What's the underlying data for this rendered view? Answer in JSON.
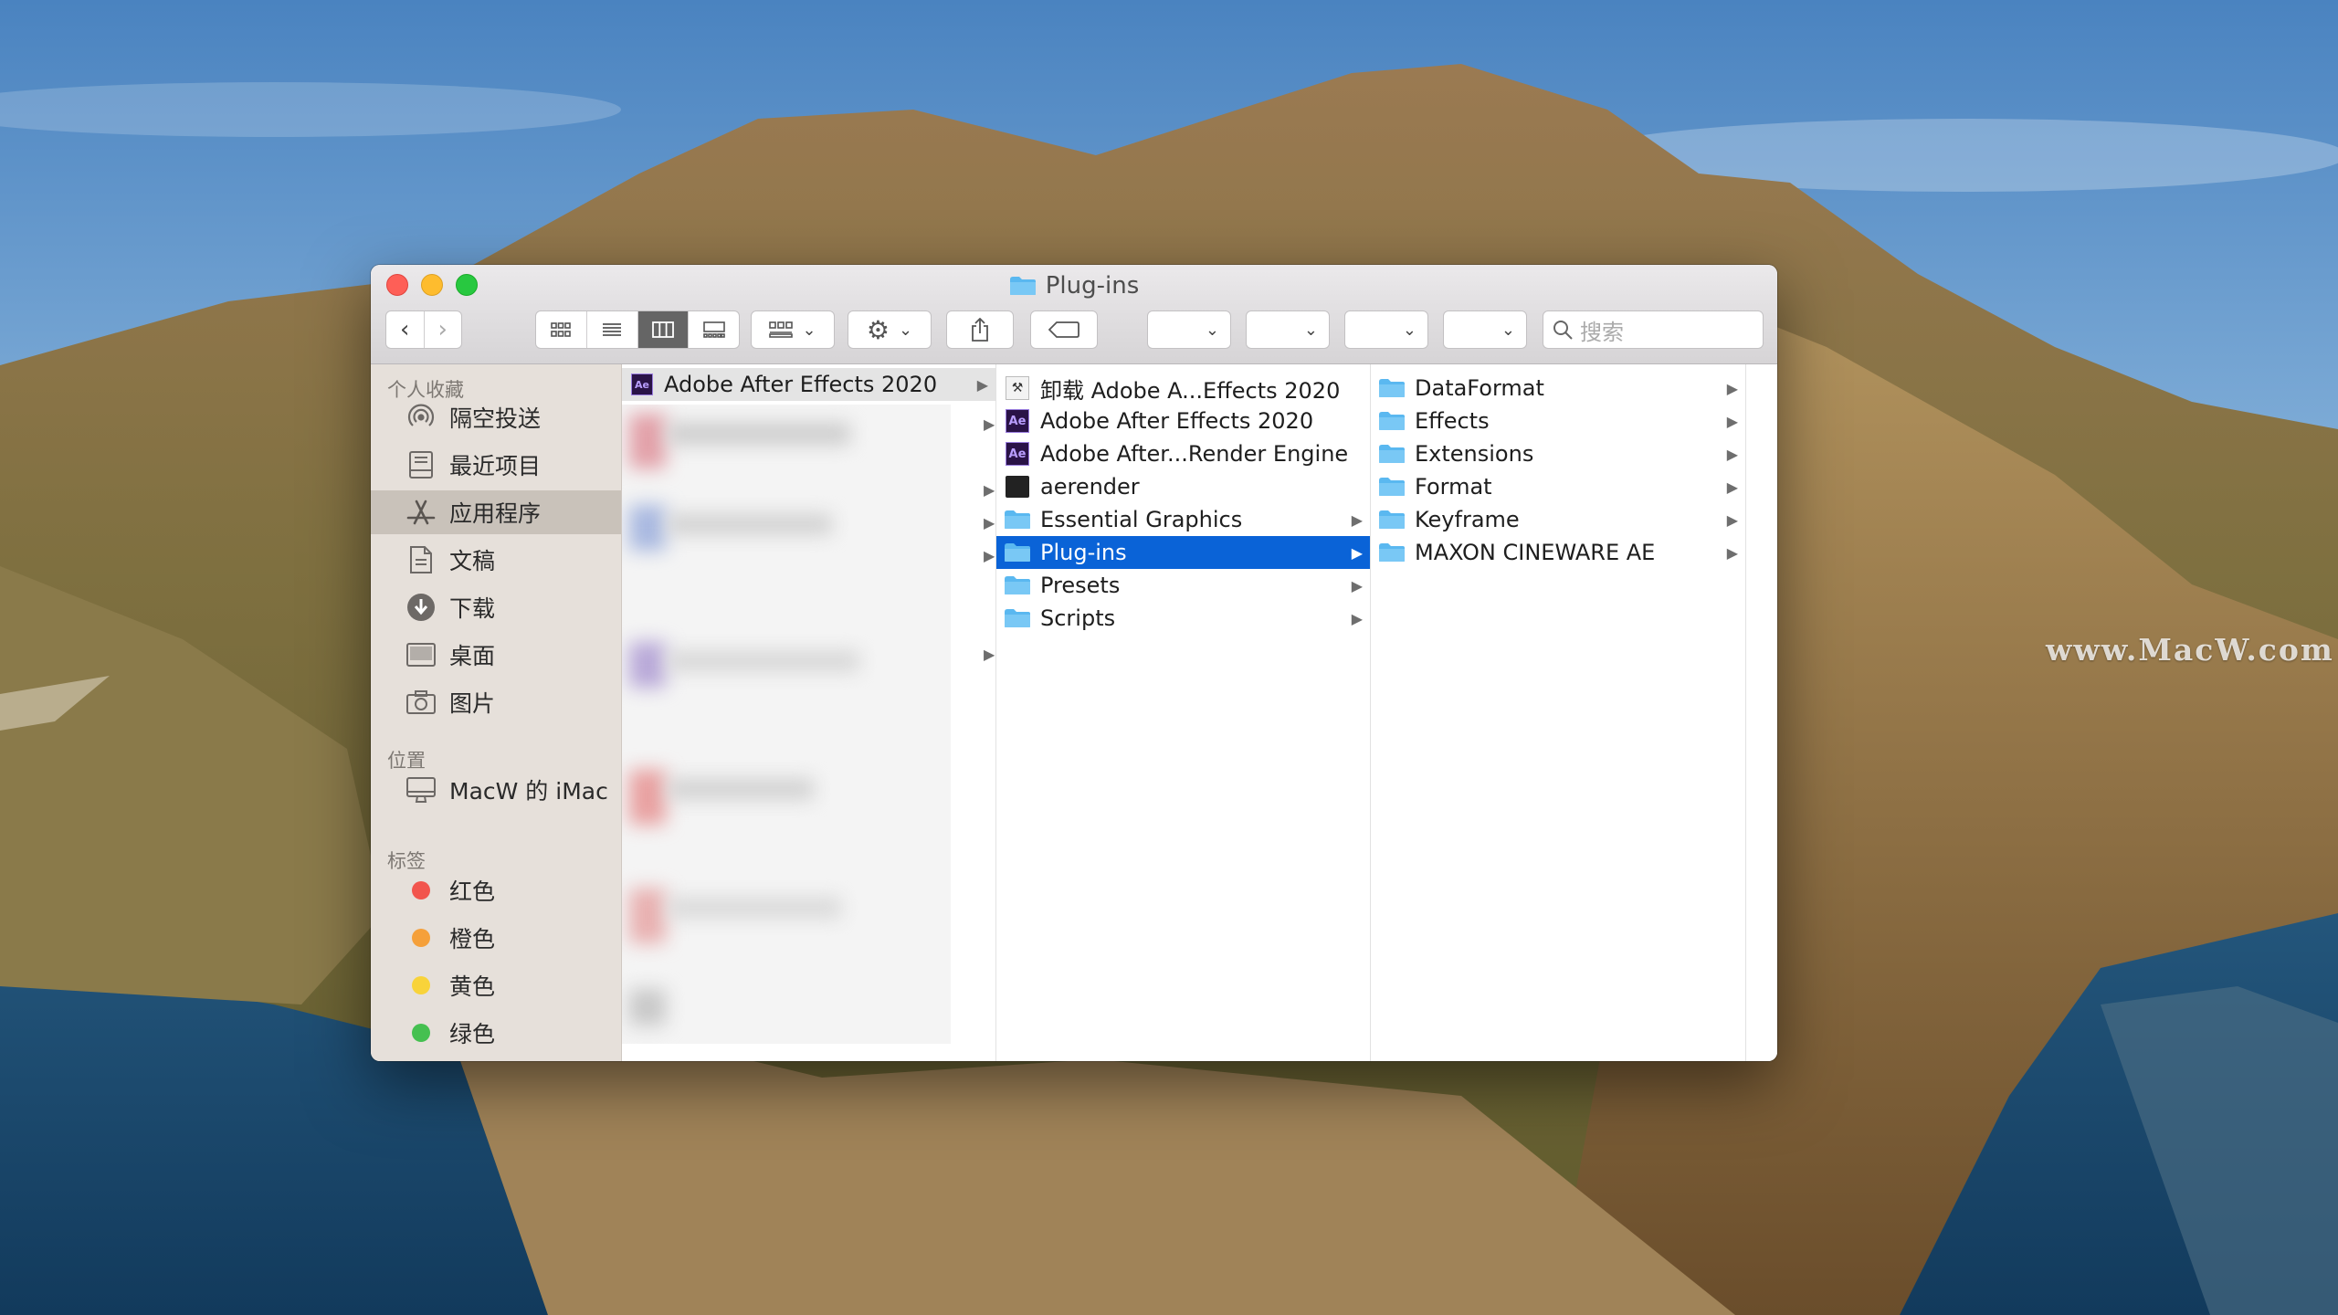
{
  "window": {
    "title": "Plug-ins"
  },
  "watermark": "www.MacW.com",
  "search": {
    "placeholder": "搜索"
  },
  "icons": {
    "back": "chevron-left-icon",
    "forward": "chevron-right-icon",
    "view_icons": "grid-icon",
    "view_list": "list-icon",
    "view_columns": "columns-icon",
    "view_gallery": "gallery-icon",
    "group": "group-icon",
    "action": "gear-icon",
    "share": "share-icon",
    "tags": "tag-icon",
    "search": "search-icon"
  },
  "sidebar": {
    "favorites_title": "个人收藏",
    "favorites": [
      {
        "label": "隔空投送",
        "icon": "airdrop-icon"
      },
      {
        "label": "最近项目",
        "icon": "recents-icon"
      },
      {
        "label": "应用程序",
        "icon": "applications-icon",
        "selected": true
      },
      {
        "label": "文稿",
        "icon": "document-icon"
      },
      {
        "label": "下载",
        "icon": "download-icon"
      },
      {
        "label": "桌面",
        "icon": "desktop-icon"
      },
      {
        "label": "图片",
        "icon": "camera-icon"
      }
    ],
    "locations_title": "位置",
    "locations": [
      {
        "label": "MacW 的 iMac",
        "icon": "imac-icon"
      }
    ],
    "tags_title": "标签",
    "tags": [
      {
        "label": "红色",
        "color": "#f2554d"
      },
      {
        "label": "橙色",
        "color": "#f5a03a"
      },
      {
        "label": "黄色",
        "color": "#f8d33a"
      },
      {
        "label": "绿色",
        "color": "#45c050"
      }
    ]
  },
  "column1": {
    "top_item": "Adobe After Effects 2020"
  },
  "column2": [
    {
      "label": "卸载 Adobe A...Effects 2020",
      "icon": "uninstaller-icon",
      "folder": false
    },
    {
      "label": "Adobe After Effects 2020",
      "icon": "ae-app-icon",
      "folder": false
    },
    {
      "label": "Adobe After...Render Engine",
      "icon": "ae-app-icon",
      "folder": false
    },
    {
      "label": "aerender",
      "icon": "terminal-icon",
      "folder": false
    },
    {
      "label": "Essential Graphics",
      "icon": "folder-icon",
      "folder": true
    },
    {
      "label": "Plug-ins",
      "icon": "folder-icon",
      "folder": true,
      "selected": true
    },
    {
      "label": "Presets",
      "icon": "folder-icon",
      "folder": true
    },
    {
      "label": "Scripts",
      "icon": "folder-icon",
      "folder": true
    }
  ],
  "column3": [
    {
      "label": "DataFormat"
    },
    {
      "label": "Effects"
    },
    {
      "label": "Extensions"
    },
    {
      "label": "Format"
    },
    {
      "label": "Keyframe"
    },
    {
      "label": "MAXON CINEWARE AE"
    }
  ],
  "colors": {
    "selection": "#0a63d7",
    "folder": "#5ab8f0",
    "sidebar": "#e6e0da"
  }
}
